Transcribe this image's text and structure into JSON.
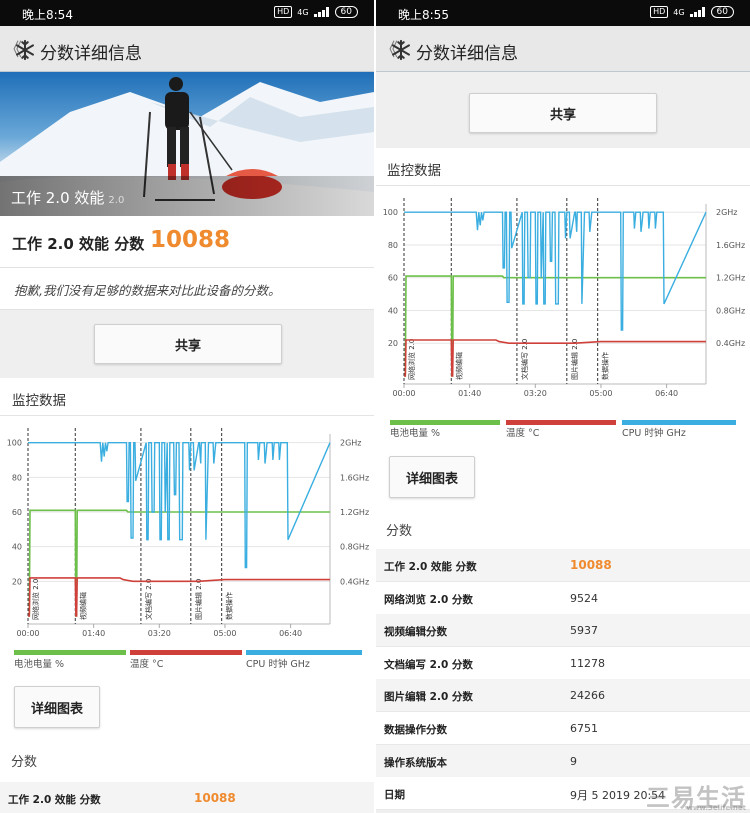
{
  "left": {
    "status": {
      "time": "晚上8:54",
      "hd": "HD",
      "network": "4G",
      "battery": "60"
    },
    "appbar": {
      "back": "《",
      "title": "分数详细信息"
    },
    "hero": {
      "title": "工作 2.0 效能",
      "version": "2.0"
    },
    "score": {
      "label": "工作 2.0 效能 分数",
      "value": "10088"
    },
    "notice": "抱歉,我们没有足够的数据来对比此设备的分数。",
    "share_label": "共享",
    "monitor_title": "监控数据",
    "detail_label": "详细图表",
    "scores_title": "分数",
    "rows": [
      {
        "k": "工作 2.0 效能 分数",
        "v": "10088"
      }
    ]
  },
  "right": {
    "status": {
      "time": "晚上8:55",
      "hd": "HD",
      "network": "4G",
      "battery": "60"
    },
    "appbar": {
      "back": "《",
      "title": "分数详细信息"
    },
    "share_label": "共享",
    "monitor_title": "监控数据",
    "detail_label": "详细图表",
    "scores_title": "分数",
    "rows": [
      {
        "k": "工作 2.0 效能 分数",
        "v": "10088"
      },
      {
        "k": "网络浏览 2.0 分数",
        "v": "9524"
      },
      {
        "k": "视频编辑分数",
        "v": "5937"
      },
      {
        "k": "文档编写 2.0 分数",
        "v": "11278"
      },
      {
        "k": "图片编辑 2.0 分数",
        "v": "24266"
      },
      {
        "k": "数据操作分数",
        "v": "6751"
      },
      {
        "k": "操作系统版本",
        "v": "9"
      },
      {
        "k": "日期",
        "v": "9月 5 2019 20:54"
      }
    ]
  },
  "watermark": {
    "main": "三易生活",
    "sub": "www.3elife.net"
  },
  "chart_data": {
    "type": "line",
    "x_ticks": [
      "00:00",
      "01:40",
      "03:20",
      "05:00",
      "06:40"
    ],
    "x_tick_values": [
      0,
      100,
      200,
      300,
      400
    ],
    "x_range": [
      0,
      460
    ],
    "y_left_ticks": [
      "20",
      "40",
      "60",
      "80",
      "100"
    ],
    "y_left_values": [
      20,
      40,
      60,
      80,
      100
    ],
    "y_right_ticks": [
      "0.4GHz",
      "0.8GHz",
      "1.2GHz",
      "1.6GHz",
      "2GHz"
    ],
    "ylim": [
      0,
      105
    ],
    "segments": [
      {
        "label": "网络浏览 2.0",
        "start": 0
      },
      {
        "label": "视频编辑",
        "start": 72
      },
      {
        "label": "文档编写 2.0",
        "start": 172
      },
      {
        "label": "图片编辑 2.0",
        "start": 248
      },
      {
        "label": "数据操作",
        "start": 295
      }
    ],
    "legend": [
      {
        "name": "电池电量 %",
        "color": "#6cc04a"
      },
      {
        "name": "温度 °C",
        "color": "#d0403a"
      },
      {
        "name": "CPU 时钟 GHz",
        "color": "#3aaee0"
      }
    ],
    "series": [
      {
        "name": "电池电量 %",
        "x": [
          0,
          2,
          3,
          72,
          73,
          74,
          75,
          150,
          152,
          460
        ],
        "y": [
          0,
          0,
          61,
          61,
          0,
          0,
          61,
          61,
          60,
          60
        ]
      },
      {
        "name": "温度 °C",
        "x": [
          0,
          2,
          3,
          72,
          73,
          74,
          75,
          140,
          145,
          160,
          180,
          220,
          260,
          300,
          340,
          380,
          420,
          460
        ],
        "y": [
          0,
          0,
          22,
          22,
          0,
          0,
          22,
          22,
          21,
          20,
          20,
          20,
          20,
          21,
          21,
          21,
          21,
          21
        ],
        "unit": "°C"
      },
      {
        "name": "CPU 时钟 GHz",
        "x": [
          0,
          110,
          112,
          114,
          116,
          118,
          120,
          122,
          150,
          151,
          153,
          154,
          156,
          157,
          160,
          161,
          163,
          164,
          180,
          181,
          183,
          184,
          188,
          189,
          192,
          193,
          200,
          201,
          203,
          204,
          208,
          209,
          212,
          213,
          215,
          216,
          222,
          223,
          225,
          226,
          230,
          231,
          235,
          236,
          245,
          246,
          248,
          249,
          252,
          253,
          260,
          261,
          263,
          264,
          270,
          271,
          275,
          276,
          282,
          283,
          286,
          287,
          330,
          331,
          333,
          334,
          350,
          351,
          353,
          354,
          360,
          361,
          363,
          364,
          372,
          373,
          375,
          376,
          382,
          383,
          385,
          386,
          395,
          396,
          460
        ],
        "y": [
          100,
          100,
          89,
          100,
          92,
          100,
          95,
          100,
          100,
          66,
          66,
          100,
          100,
          45,
          45,
          100,
          100,
          78,
          100,
          44,
          44,
          100,
          100,
          60,
          60,
          100,
          100,
          44,
          44,
          100,
          100,
          60,
          100,
          44,
          44,
          100,
          100,
          70,
          70,
          100,
          100,
          44,
          44,
          100,
          100,
          84,
          100,
          100,
          100,
          84,
          100,
          100,
          88,
          100,
          100,
          44,
          100,
          100,
          100,
          88,
          100,
          100,
          100,
          28,
          28,
          100,
          100,
          90,
          100,
          100,
          100,
          88,
          95,
          100,
          100,
          90,
          100,
          100,
          100,
          90,
          100,
          100,
          100,
          44,
          100
        ],
        "unit": "GHz"
      }
    ]
  }
}
